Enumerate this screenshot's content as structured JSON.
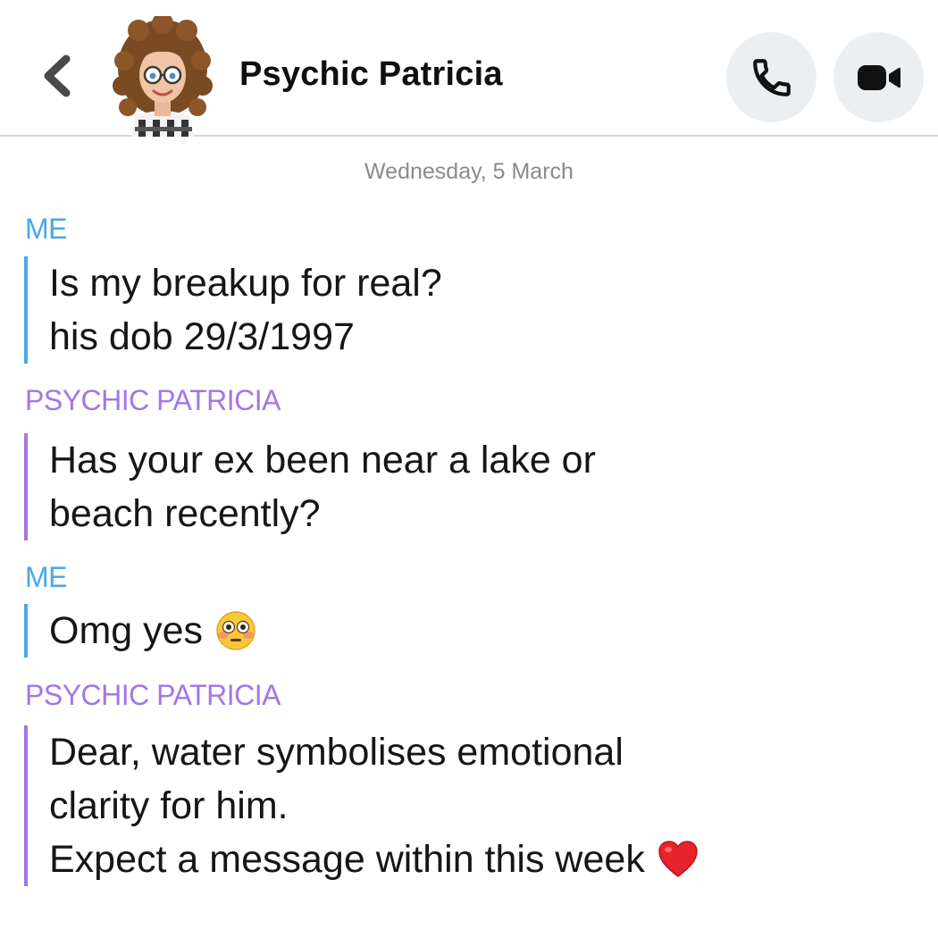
{
  "header": {
    "contact_name": "Psychic Patricia",
    "back_icon": "chevron-left-icon",
    "call_icon": "phone-icon",
    "video_icon": "video-camera-icon"
  },
  "date_separator": "Wednesday, 5 March",
  "colors": {
    "me": "#4aa8ea",
    "patricia": "#a276e8",
    "date": "#8a8a8a"
  },
  "messages": [
    {
      "sender": "ME",
      "lines": [
        "Is my breakup for real?",
        "his dob 29/3/1997"
      ]
    },
    {
      "sender": "PSYCHIC PATRICIA",
      "lines": [
        "Has your ex been near a lake or",
        "beach recently?"
      ]
    },
    {
      "sender": "ME",
      "lines": [
        "Omg yes"
      ],
      "emoji": "flushed-face-icon"
    },
    {
      "sender": "PSYCHIC PATRICIA",
      "lines": [
        "Dear, water symbolises emotional",
        "clarity for him.",
        "Expect a message within this week"
      ],
      "emoji": "red-heart-icon"
    }
  ]
}
